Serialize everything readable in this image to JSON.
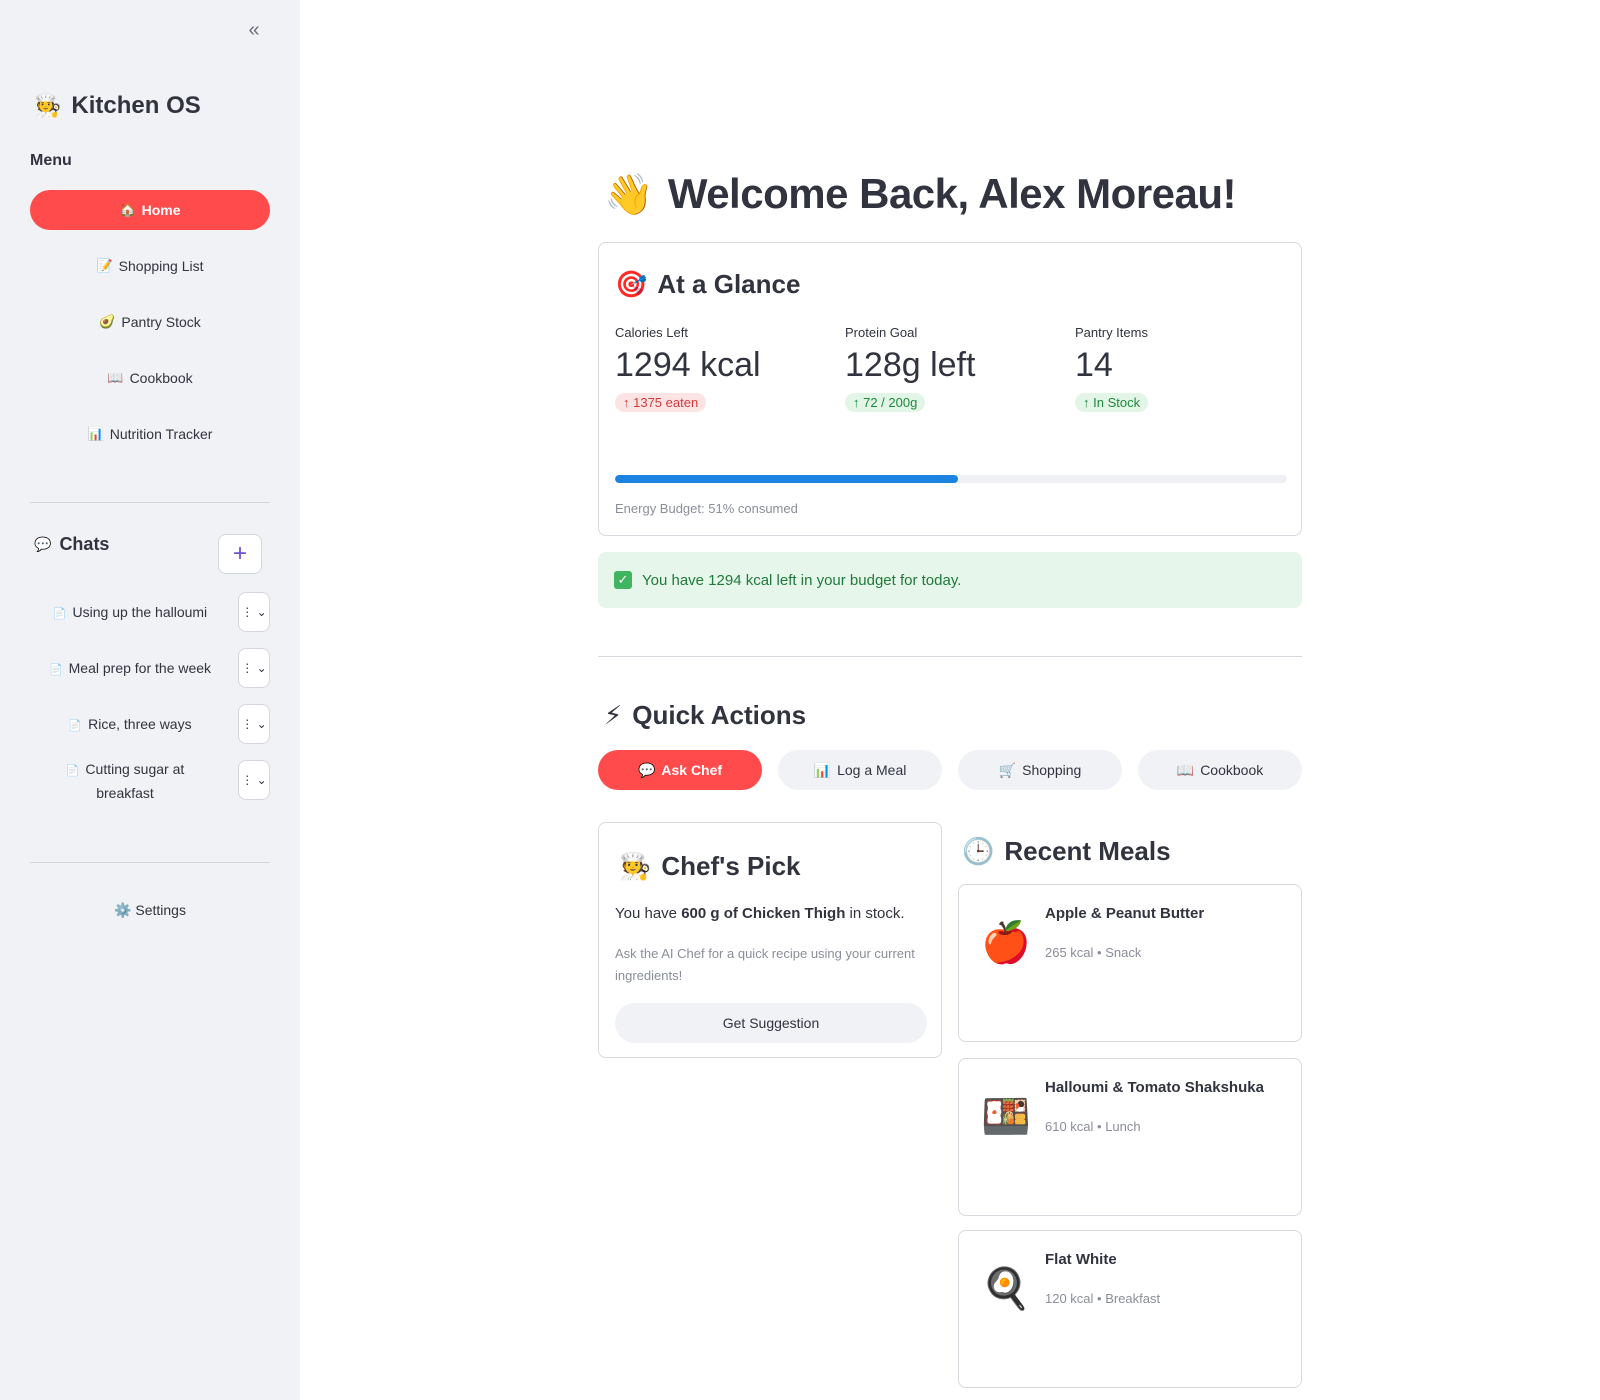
{
  "sidebar": {
    "collapse_icon": "«",
    "brand_emoji": "🧑‍🍳",
    "brand_title": "Kitchen OS",
    "menu_label": "Menu",
    "nav": [
      {
        "icon": "🏠",
        "label": "Home",
        "active": true
      },
      {
        "icon": "📝",
        "label": "Shopping List"
      },
      {
        "icon": "🥑",
        "label": "Pantry Stock"
      },
      {
        "icon": "📖",
        "label": "Cookbook"
      },
      {
        "icon": "📊",
        "label": "Nutrition Tracker"
      }
    ],
    "chats_icon": "💬",
    "chats_label": "Chats",
    "new_chat_icon": "+",
    "chats": [
      {
        "icon": "📄",
        "label": "Using up the halloumi",
        "menu_icon": "⋮ ⌄"
      },
      {
        "icon": "📄",
        "label": "Meal prep for the week",
        "menu_icon": "⋮ ⌄"
      },
      {
        "icon": "📄",
        "label": "Rice, three ways",
        "menu_icon": "⋮ ⌄"
      },
      {
        "icon": "📄",
        "label": "Cutting sugar at breakfast",
        "menu_icon": "⋮ ⌄"
      }
    ],
    "settings_icon": "⚙️",
    "settings_label": "Settings"
  },
  "main": {
    "welcome_emoji": "👋",
    "welcome_title": "Welcome Back, Alex Moreau!",
    "glance": {
      "emoji": "🎯",
      "title": "At a Glance",
      "metrics": [
        {
          "label": "Calories Left",
          "value": "1294 kcal",
          "delta": "↑ 1375 eaten",
          "tone": "red"
        },
        {
          "label": "Protein Goal",
          "value": "128g left",
          "delta": "↑ 72 / 200g",
          "tone": "green"
        },
        {
          "label": "Pantry Items",
          "value": "14",
          "delta": "↑ In Stock",
          "tone": "green"
        }
      ],
      "progress": 0.51,
      "progress_caption": "Energy Budget: 51% consumed"
    },
    "alert": {
      "icon": "✓",
      "text": "You have 1294 kcal left in your budget for today."
    },
    "quick_actions": {
      "emoji": "⚡",
      "title": "Quick Actions",
      "buttons": [
        {
          "icon": "💬",
          "label": "Ask Chef",
          "primary": true
        },
        {
          "icon": "📊",
          "label": "Log a Meal"
        },
        {
          "icon": "🛒",
          "label": "Shopping"
        },
        {
          "icon": "📖",
          "label": "Cookbook"
        }
      ]
    },
    "chef_pick": {
      "emoji": "🧑‍🍳",
      "title": "Chef's Pick",
      "text_prefix": "You have ",
      "text_bold": "600 g of Chicken Thigh",
      "text_suffix": " in stock.",
      "description": "Ask the AI Chef for a quick recipe using your current ingredients!",
      "button_label": "Get Suggestion"
    },
    "recent_meals": {
      "emoji": "🕒",
      "title": "Recent Meals",
      "items": [
        {
          "icon": "🍎",
          "name": "Apple & Peanut Butter",
          "meta": "265 kcal • Snack"
        },
        {
          "icon": "🍱",
          "name": "Halloumi & Tomato Shakshuka",
          "meta": "610 kcal • Lunch"
        },
        {
          "icon": "🍳",
          "name": "Flat White",
          "meta": "120 kcal • Breakfast"
        }
      ]
    }
  }
}
